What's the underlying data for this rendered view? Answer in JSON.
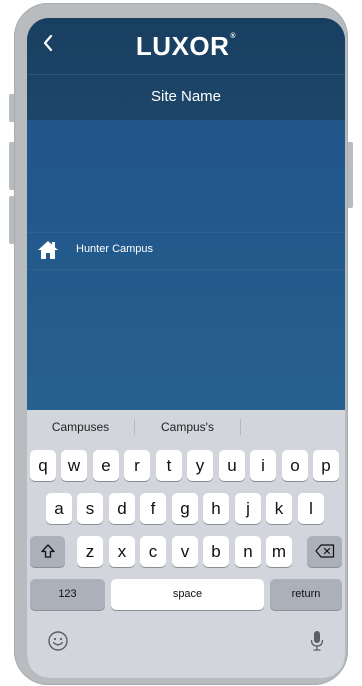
{
  "header": {
    "back_icon": "chevron-left-icon",
    "logo": "LUXOR",
    "logo_mark": "®",
    "title": "Site Name"
  },
  "site": {
    "icon": "home-icon",
    "label": "Hunter Campus"
  },
  "keyboard": {
    "suggestions": [
      "Campuses",
      "Campus's",
      ""
    ],
    "row1": [
      "q",
      "w",
      "e",
      "r",
      "t",
      "y",
      "u",
      "i",
      "o",
      "p"
    ],
    "row2": [
      "a",
      "s",
      "d",
      "f",
      "g",
      "h",
      "j",
      "k",
      "l"
    ],
    "row3": [
      "z",
      "x",
      "c",
      "v",
      "b",
      "n",
      "m"
    ],
    "numbers_label": "123",
    "space_label": "space",
    "return_label": "return",
    "shift_icon": "shift-icon",
    "delete_icon": "delete-icon",
    "emoji_icon": "emoji-icon",
    "mic_icon": "microphone-icon"
  },
  "colors": {
    "header_bg": "#1a4365",
    "content_bg": "#235a8c",
    "keyboard_bg": "#d2d5db",
    "frame": "#b9bcbf"
  }
}
